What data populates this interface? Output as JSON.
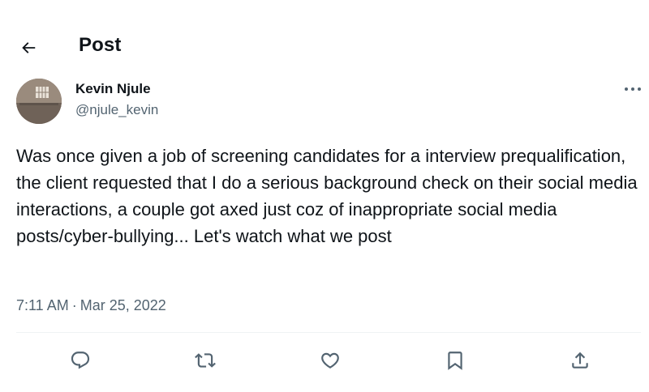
{
  "header": {
    "title": "Post",
    "back_icon": "arrow-left-icon"
  },
  "author": {
    "name": "Kevin Njule",
    "handle": "@njule_kevin",
    "avatar_icon": "avatar-photo"
  },
  "post": {
    "text": "Was once given a job of screening candidates for a interview prequalification, the client requested that I do a serious background check on their social media interactions, a couple got axed just coz of inappropriate social media posts/cyber-bullying... Let's watch what we post",
    "time": "7:11 AM",
    "separator": "·",
    "date": "Mar 25, 2022"
  },
  "actions": {
    "items": [
      "reply-icon",
      "repost-icon",
      "like-icon",
      "bookmark-icon",
      "share-icon"
    ],
    "color": "#536471"
  },
  "colors": {
    "text_primary": "#0f1419",
    "text_secondary": "#536471",
    "divider": "#eff3f4"
  }
}
